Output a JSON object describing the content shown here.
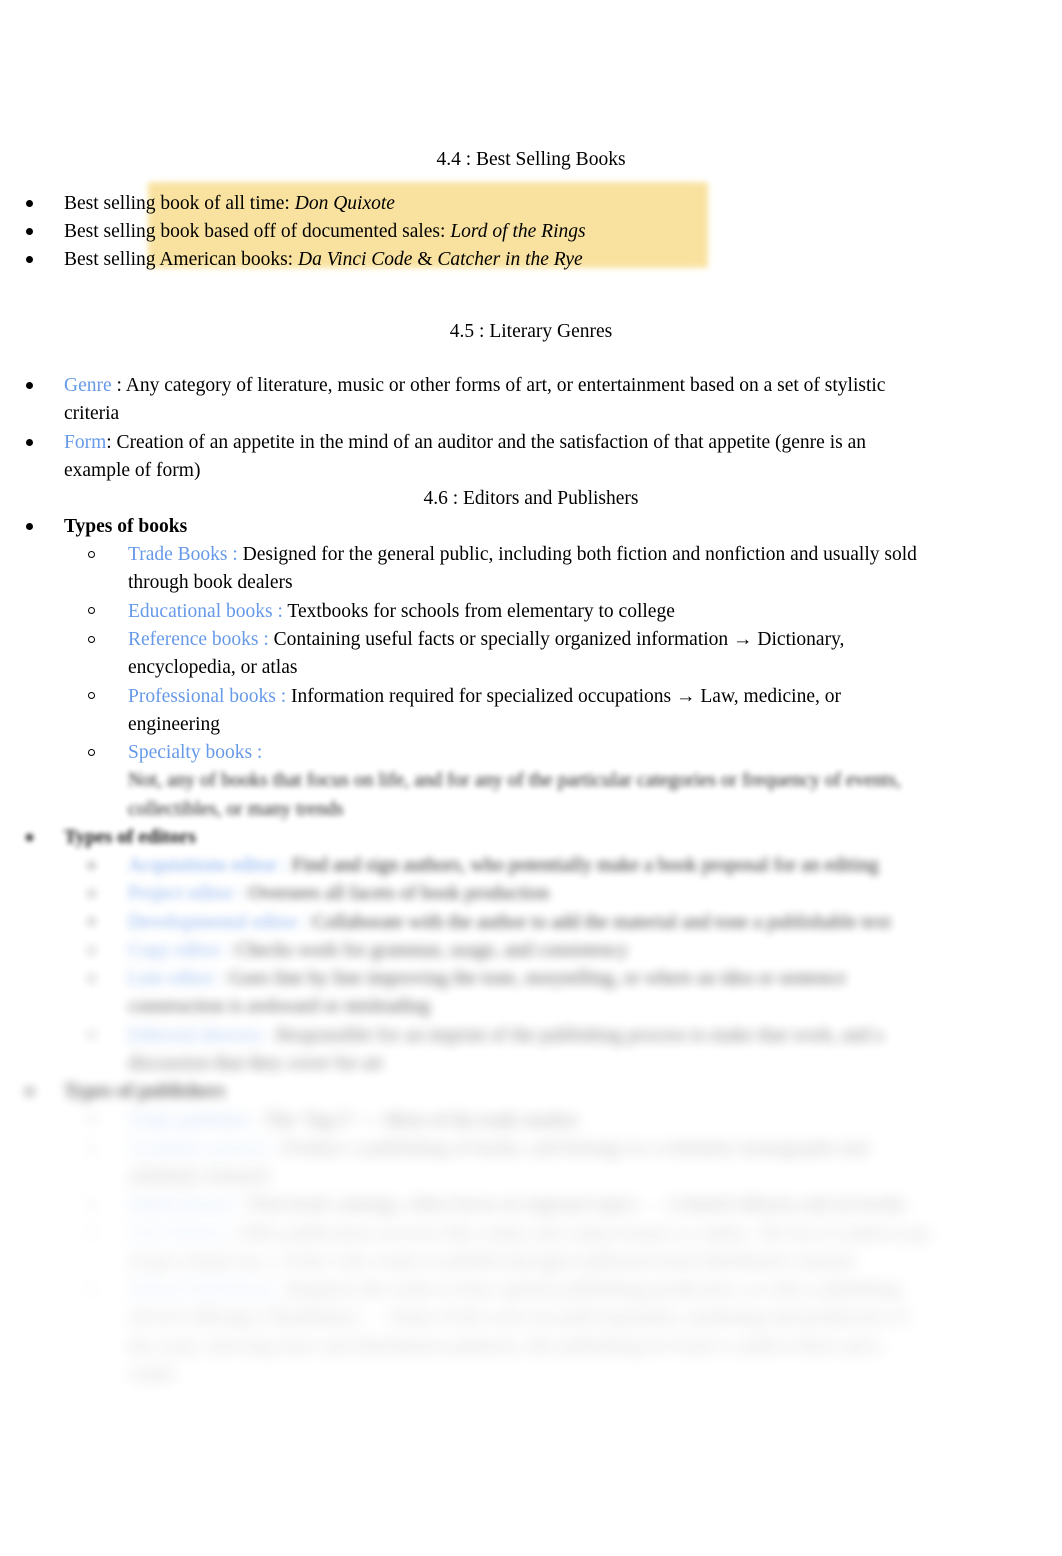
{
  "document": {
    "title": "4.4 : Best Selling Books"
  },
  "sections": {
    "best_selling": {
      "heading": "4.4 : Best Selling Books",
      "items": [
        {
          "lead": "Best selling book of all time: ",
          "work": "Don Quixote"
        },
        {
          "lead": "Best selling book based off of documented sales: ",
          "work": "Lord of the Rings"
        },
        {
          "lead": "Best selling American books: ",
          "work": "Da Vinci Code",
          "conj": " & ",
          "work2": "Catcher in the Rye"
        }
      ]
    },
    "literary_genres": {
      "heading": "4.5 : Literary Genres",
      "items": [
        {
          "term": "Genre",
          "body": " : Any category of literature, music or other forms of art, or entertainment based on a set of stylistic criteria"
        },
        {
          "term": "Form",
          "body": ": Creation of an appetite in the mind of an auditor and the satisfaction of that appetite (genre is an example of form)"
        }
      ]
    },
    "editors_publishers": {
      "heading": "4.6 : Editors and Publishers",
      "types_of_books": {
        "label": "Types of books",
        "items": [
          {
            "term": "Trade Books :",
            "body": " Designed for the general public, including both fiction and nonfiction and usually sold through book dealers"
          },
          {
            "term": "Educational books :",
            "body": " Textbooks for schools from elementary to college"
          },
          {
            "term": "Reference books :",
            "body": " Containing useful facts or specially organized information → Dictionary, encyclopedia, or atlas"
          },
          {
            "term": "Professional books :",
            "body": " Information required for specialized occupations → Law, medicine, or engineering"
          },
          {
            "term": "Specialty books :",
            "body": " Not, any of books that focus on life, and for any of the particular categories or frequency of events, collectibles, or many trends",
            "obscured": true
          }
        ]
      },
      "types_of_editors": {
        "label": "Types of editors",
        "obscured": true,
        "items": [
          {
            "term": "Acquisitions editor :",
            "body": " Find and sign authors, who potentially make a book proposal for an editing",
            "obscured": true
          },
          {
            "term": "Project editor :",
            "body": " Oversees all facets of book production",
            "obscured": true
          },
          {
            "term": "Developmental editor :",
            "body": " Collaborate with the author to add the material and tone a publishable text",
            "obscured": true
          },
          {
            "term": "Copy editor :",
            "body": " Checks work for grammar, usage, and consistency",
            "obscured": true
          },
          {
            "term": "Line editor :",
            "body": " Goes line by line improving the tone, storytelling, or where an idea or sentence construction is awkward or misleading",
            "obscured": true
          },
          {
            "term": "Editorial director :",
            "body": " Responsible for an imprint of the publishing process to make that work, and a discussion that they cover for art",
            "obscured": true
          }
        ]
      },
      "types_of_publishers": {
        "label": "Types of publishers",
        "obscured": true,
        "items": [
          {
            "term": "Trade publisher :",
            "body": " The \"big 5\" — Most of the trade market",
            "obscured": true
          },
          {
            "term": "Academic presses :",
            "body": " Produce a publishing of books, and belongs to a scholarly monographs and scholarly research",
            "obscured": true
          },
          {
            "term": "Small presses :",
            "body": " Post-book catalogs, often focus on regional topics → Limited editions and art books",
            "obscured": true
          },
          {
            "term": "Self Publish :",
            "body": " Offer publication services like vanity and vanity houses or online. The list of authors pay to put a book out, a writer who wants to publish through traditional book distribution channel",
            "obscured": true
          },
          {
            "term": "Hybrid Publishing :",
            "body": " Requires the writer to bear upfront publishing production, so with a publishing service offering a distribution → Some of the costs are paid separately, marketing and production of the work, showing more and distribution platform, this publishing for book is underwritten and a reader",
            "obscured": true
          }
        ]
      }
    }
  },
  "colors": {
    "term_blue": "#6699e8",
    "highlight_yellow": "#f9e2a0",
    "text_black": "#000000",
    "page_background": "#ffffff"
  }
}
